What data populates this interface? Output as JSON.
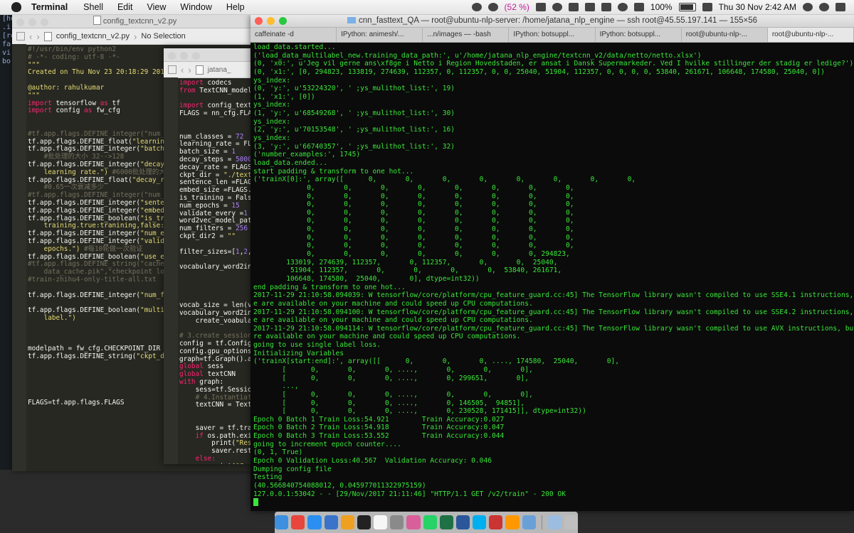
{
  "menubar": {
    "app": "Terminal",
    "menus": [
      "Shell",
      "Edit",
      "View",
      "Window",
      "Help"
    ],
    "battery": "(52 %)",
    "battery_pct": "100%",
    "clock": "Thu 30 Nov  2:42 AM"
  },
  "strip": [
    "[ho",
    ".i",
    "[ro",
    "fa",
    "vi",
    "bo"
  ],
  "editor1": {
    "title": "config_textcnn_v2.py",
    "tab": "config_textcnn_v2.py",
    "selection": "No Selection",
    "lines": [
      [
        {
          "t": "#!/usr/bin/env python2",
          "c": "cm"
        }
      ],
      [
        {
          "t": "# -*- coding: utf-8 -*-",
          "c": "cm"
        }
      ],
      [
        {
          "t": "\"\"\"",
          "c": "str"
        }
      ],
      [
        {
          "t": "Created on Thu Nov 23 20:18:29 201",
          "c": "str"
        }
      ],
      [],
      [
        {
          "t": "@author: rahulkumar",
          "c": "str"
        }
      ],
      [
        {
          "t": "\"\"\"",
          "c": "str"
        }
      ],
      [
        {
          "t": "import ",
          "c": "kw"
        },
        {
          "t": "tensorflow ",
          "c": ""
        },
        {
          "t": "as ",
          "c": "kw"
        },
        {
          "t": "tf",
          "c": ""
        }
      ],
      [
        {
          "t": "import ",
          "c": "kw"
        },
        {
          "t": "config ",
          "c": ""
        },
        {
          "t": "as ",
          "c": "kw"
        },
        {
          "t": "fw_cfg",
          "c": ""
        }
      ],
      [],
      [],
      [
        {
          "t": "#tf.app.flags.DEFINE_integer(\"num_c",
          "c": "cm"
        }
      ],
      [
        {
          "t": "tf.app.flags.DEFINE_float(",
          "c": ""
        },
        {
          "t": "\"learnin",
          "c": "str"
        }
      ],
      [
        {
          "t": "tf.app.flags.DEFINE_integer(",
          "c": ""
        },
        {
          "t": "\"batch_",
          "c": "str"
        }
      ],
      [
        {
          "t": "    #批处理的大小 32-->128",
          "c": "cm"
        }
      ],
      [
        {
          "t": "tf.app.flags.DEFINE_integer(",
          "c": ""
        },
        {
          "t": "\"decay_",
          "c": "str"
        }
      ],
      [
        {
          "t": "    learning rate.\")",
          "c": "str"
        },
        {
          "t": " #6000批处理的大小",
          "c": "cm"
        }
      ],
      [
        {
          "t": "tf.app.flags.DEFINE_float(",
          "c": ""
        },
        {
          "t": "\"decay_ra",
          "c": "str"
        }
      ],
      [
        {
          "t": "    #0.65一次衰减多少",
          "c": "cm"
        }
      ],
      [
        {
          "t": "#tf.app.flags.DEFINE_integer(\"num_s",
          "c": "cm"
        }
      ],
      [
        {
          "t": "tf.app.flags.DEFINE_integer(",
          "c": ""
        },
        {
          "t": "\"senten",
          "c": "str"
        }
      ],
      [
        {
          "t": "tf.app.flags.DEFINE_integer(",
          "c": ""
        },
        {
          "t": "\"embed_",
          "c": "str"
        }
      ],
      [
        {
          "t": "tf.app.flags.DEFINE_boolean(",
          "c": ""
        },
        {
          "t": "\"is_tra",
          "c": "str"
        }
      ],
      [
        {
          "t": "    training.true:tranining,false:te",
          "c": "str"
        }
      ],
      [
        {
          "t": "tf.app.flags.DEFINE_integer(",
          "c": ""
        },
        {
          "t": "\"num_ep",
          "c": "str"
        }
      ],
      [
        {
          "t": "tf.app.flags.DEFINE_integer(",
          "c": ""
        },
        {
          "t": "\"valida",
          "c": "str"
        }
      ],
      [
        {
          "t": "    epochs.\")",
          "c": "str"
        },
        {
          "t": " #每10轮做一次验证",
          "c": "cm"
        }
      ],
      [
        {
          "t": "tf.app.flags.DEFINE_boolean(",
          "c": ""
        },
        {
          "t": "\"use_em",
          "c": "str"
        }
      ],
      [
        {
          "t": "#tf.app.flags.DEFINE_string(\"cache_p",
          "c": "cm"
        }
      ],
      [
        {
          "t": "    data_cache.pik\",\"checkpoint loc",
          "c": "cm"
        }
      ],
      [
        {
          "t": "#train-zhihu4-only-title-all.txt",
          "c": "cm"
        }
      ],
      [],
      [
        {
          "t": "tf.app.flags.DEFINE_integer(",
          "c": ""
        },
        {
          "t": "\"num_fi",
          "c": "str"
        }
      ],
      [],
      [
        {
          "t": "tf.app.flags.DEFINE_boolean(",
          "c": ""
        },
        {
          "t": "\"multi_",
          "c": "str"
        }
      ],
      [
        {
          "t": "    label.\")",
          "c": "str"
        }
      ],
      [],
      [],
      [],
      [
        {
          "t": "modelpath = fw_cfg.CHECKPOINT_DIR",
          "c": ""
        }
      ],
      [
        {
          "t": "tf.app.flags.DEFINE_string(",
          "c": ""
        },
        {
          "t": "\"ckpt_di",
          "c": "str"
        }
      ],
      [],
      [],
      [],
      [],
      [],
      [
        {
          "t": "FLAGS=tf.app.flags.FLAGS",
          "c": ""
        }
      ]
    ]
  },
  "editor2": {
    "tab": "jatana_",
    "lines": [
      [
        {
          "t": "import ",
          "c": "kw"
        },
        {
          "t": "codecs",
          "c": ""
        }
      ],
      [
        {
          "t": "from ",
          "c": "kw"
        },
        {
          "t": "TextCNN_model",
          "c": ""
        }
      ],
      [],
      [
        {
          "t": "import ",
          "c": "kw"
        },
        {
          "t": "config_text",
          "c": ""
        }
      ],
      [
        {
          "t": "FLAGS = nn_cfg.FLA",
          "c": ""
        }
      ],
      [],
      [],
      [
        {
          "t": "num_classes = ",
          "c": ""
        },
        {
          "t": "72",
          "c": "num"
        }
      ],
      [
        {
          "t": "learning_rate = FL",
          "c": ""
        }
      ],
      [
        {
          "t": "batch_size = ",
          "c": ""
        },
        {
          "t": "1",
          "c": "num"
        }
      ],
      [
        {
          "t": "decay_steps = ",
          "c": ""
        },
        {
          "t": "5000",
          "c": "num"
        }
      ],
      [
        {
          "t": "decay_rate = FLAGS",
          "c": ""
        }
      ],
      [
        {
          "t": "ckpt_dir = ",
          "c": ""
        },
        {
          "t": "\"./text",
          "c": "str"
        }
      ],
      [
        {
          "t": "sentence_len =FLAG",
          "c": ""
        }
      ],
      [
        {
          "t": "embed_size =FLAGS.",
          "c": ""
        }
      ],
      [
        {
          "t": "is_training = Fals",
          "c": ""
        }
      ],
      [
        {
          "t": "num_epochs = ",
          "c": ""
        },
        {
          "t": "15",
          "c": "num"
        }
      ],
      [
        {
          "t": "validate_every =",
          "c": ""
        },
        {
          "t": "1",
          "c": "num"
        }
      ],
      [
        {
          "t": "word2vec_model_pat",
          "c": ""
        }
      ],
      [
        {
          "t": "num_filters = ",
          "c": ""
        },
        {
          "t": "256",
          "c": "num"
        }
      ],
      [
        {
          "t": "ckpt_dir2 = ",
          "c": ""
        },
        {
          "t": "\"\"",
          "c": "str"
        }
      ],
      [],
      [
        {
          "t": "filter_sizes=[",
          "c": ""
        },
        {
          "t": "1",
          "c": "num"
        },
        {
          "t": ",",
          "c": ""
        },
        {
          "t": "2",
          "c": "num"
        },
        {
          "t": ",",
          "c": ""
        }
      ],
      [],
      [
        {
          "t": "vocabulary_word2in",
          "c": ""
        }
      ],
      [],
      [],
      [],
      [],
      [
        {
          "t": "vocab_size = len(v",
          "c": ""
        }
      ],
      [
        {
          "t": "vocabulary_word2in",
          "c": ""
        }
      ],
      [
        {
          "t": "    create_voabula",
          "c": ""
        }
      ],
      [],
      [
        {
          "t": "# 3.create session",
          "c": "cm"
        }
      ],
      [
        {
          "t": "config = tf.Config",
          "c": ""
        }
      ],
      [
        {
          "t": "config.gpu_options",
          "c": ""
        }
      ],
      [
        {
          "t": "graph=tf.Graph().a",
          "c": ""
        }
      ],
      [
        {
          "t": "global ",
          "c": "kw"
        },
        {
          "t": "sess",
          "c": ""
        }
      ],
      [
        {
          "t": "global ",
          "c": "kw"
        },
        {
          "t": "textCNN",
          "c": ""
        }
      ],
      [
        {
          "t": "with ",
          "c": "kw"
        },
        {
          "t": "graph:",
          "c": ""
        }
      ],
      [
        {
          "t": "    sess=tf.Sessio",
          "c": ""
        }
      ],
      [
        {
          "t": "    # 4.Instantiat",
          "c": "cm"
        }
      ],
      [
        {
          "t": "    textCNN = Text",
          "c": ""
        }
      ],
      [],
      [],
      [
        {
          "t": "    saver = tf.tra",
          "c": ""
        }
      ],
      [
        {
          "t": "    ",
          "c": ""
        },
        {
          "t": "if ",
          "c": "kw"
        },
        {
          "t": "os.path.exi",
          "c": ""
        }
      ],
      [
        {
          "t": "        print(",
          "c": ""
        },
        {
          "t": "\"Res",
          "c": "str"
        }
      ],
      [
        {
          "t": "        saver.rest",
          "c": ""
        }
      ],
      [
        {
          "t": "    ",
          "c": ""
        },
        {
          "t": "else:",
          "c": "kw"
        }
      ],
      [
        {
          "t": "        print(",
          "c": ""
        },
        {
          "t": "\"Can",
          "c": "str"
        }
      ]
    ]
  },
  "terminal": {
    "title": "cnn_fasttext_QA — root@ubuntu-nlp-server: /home/jatana_nlp_engine — ssh root@45.55.197.141 — 155×56",
    "tabs": [
      {
        "label": "caffeinate -d",
        "active": false
      },
      {
        "label": "IPython: animesh/...",
        "active": false
      },
      {
        "label": "...n/images — -bash",
        "active": false
      },
      {
        "label": "IPython: botsuppl...",
        "active": false
      },
      {
        "label": "IPython: botsuppl...",
        "active": false
      },
      {
        "label": "root@ubuntu-nlp-...",
        "active": false
      },
      {
        "label": "root@ubuntu-nlp-...",
        "active": true
      }
    ],
    "lines": [
      "load_data.started...",
      "('load_data_multilabel_new.training_data_path:', u'/home/jatana_nlp_engine/textcnn_v2/data/netto/netto.xlsx')",
      "(0, 'x0:', u'Jeg vil gerne ans\\xf8ge i Netto i Region Hovedstaden, er ansat i Dansk Supermarkeder. Ved I hvilke stillinger der stadig er ledige?')",
      "(0, 'x1:', [0, 294823, 133819, 274639, 112357, 0, 112357, 0, 0, 25040, 51904, 112357, 0, 0, 0, 0, 53840, 261671, 106648, 174580, 25040, 0])",
      "ys_index:",
      "(0, 'y:', u'53224320', ' ;ys_mulithot_list:', 19)",
      "(1, 'x1:', [0])",
      "ys_index:",
      "(1, 'y:', u'68549268', ' ;ys_mulithot_list:', 30)",
      "ys_index:",
      "(2, 'y:', u'70153548', ' ;ys_mulithot_list:', 16)",
      "ys_index:",
      "(3, 'y:', u'66740357', ' ;ys_mulithot_list:', 32)",
      "('number_examples:', 1745)",
      "load_data.ended...",
      "start padding & transform to one hot...",
      "('trainX[0]:', array([      0,       0,       0,       0,       0,       0,       0,       0,",
      "             0,       0,       0,       0,       0,       0,       0,       0,",
      "             0,       0,       0,       0,       0,       0,       0,       0,",
      "             0,       0,       0,       0,       0,       0,       0,       0,",
      "             0,       0,       0,       0,       0,       0,       0,       0,",
      "             0,       0,       0,       0,       0,       0,       0,       0,",
      "             0,       0,       0,       0,       0,       0,       0,       0,",
      "             0,       0,       0,       0,       0,       0,       0,       0,",
      "             0,       0,       0,       0,       0,       0,       0,       0,",
      "             0,       0,       0,       0,       0,       0,       0, 294823,",
      "        133019, 274639, 112357,       0, 112357,       0,       0,  25040,",
      "         51904, 112357,       0,       0,       0,       0,  53840, 261671,",
      "        106648, 174580,  25040,       0], dtype=int32))",
      "end padding & transform to one hot...",
      "2017-11-29 21:10:58.094039: W tensorflow/core/platform/cpu_feature_guard.cc:45] The TensorFlow library wasn't compiled to use SSE4.1 instructions, but thes",
      "e are available on your machine and could speed up CPU computations.",
      "2017-11-29 21:10:58.094100: W tensorflow/core/platform/cpu_feature_guard.cc:45] The TensorFlow library wasn't compiled to use SSE4.2 instructions, but thes",
      "e are available on your machine and could speed up CPU computations.",
      "2017-11-29 21:10:58.094114: W tensorflow/core/platform/cpu_feature_guard.cc:45] The TensorFlow library wasn't compiled to use AVX instructions, but these a",
      "re available on your machine and could speed up CPU computations.",
      "going to use single label loss.",
      "Initializing Variables",
      "('trainX[start:end]:', array([[      0,       0,       0, ...., 174580,  25040,       0],",
      "       [      0,       0,       0, ....,       0,       0,       0],",
      "       [      0,       0,       0, ....,       0, 299651,       0],",
      "       ...,",
      "       [      0,       0,       0, ....,       0,       0,       0],",
      "       [      0,       0,       0, ....,       0, 146505,  94851],",
      "       [      0,       0,       0, ....,       0, 230528, 171415]], dtype=int32))",
      "Epoch 0 Batch 1 Train Loss:54.921        Train Accuracy:0.027",
      "Epoch 0 Batch 2 Train Loss:54.918        Train Accuracy:0.047",
      "Epoch 0 Batch 3 Train Loss:53.552        Train Accuracy:0.044",
      "going to increment epoch counter....",
      "(0, 1, True)",
      "Epoch 0 Validation Loss:40.567  Validation Accuracy: 0.046",
      "Dumping config file",
      "Testing",
      "(40.566840754088012, 0.045977011322975159)",
      "127.0.0.1:53042 - - [29/Nov/2017 21:11:46] \"HTTP/1.1 GET /v2/train\" - 200 OK"
    ]
  },
  "dock": {
    "icons": [
      {
        "name": "finder-icon",
        "color": "#3d8fe0"
      },
      {
        "name": "chrome-icon",
        "color": "#e8453c"
      },
      {
        "name": "safari-icon",
        "color": "#2a8ff0"
      },
      {
        "name": "xcode-icon",
        "color": "#3a73c9"
      },
      {
        "name": "pages-icon",
        "color": "#f0a020"
      },
      {
        "name": "terminal-icon",
        "color": "#222222"
      },
      {
        "name": "calendar-icon",
        "color": "#f6f6f6"
      },
      {
        "name": "system-preferences-icon",
        "color": "#8a8a8a"
      },
      {
        "name": "photos-icon",
        "color": "#d95f9a"
      },
      {
        "name": "whatsapp-icon",
        "color": "#25d366"
      },
      {
        "name": "excel-icon",
        "color": "#1e7145"
      },
      {
        "name": "word-icon",
        "color": "#2b579a"
      },
      {
        "name": "skype-icon",
        "color": "#00aff0"
      },
      {
        "name": "app-icon",
        "color": "#cc3333"
      },
      {
        "name": "sublime-text-icon",
        "color": "#ff9800"
      },
      {
        "name": "preview-icon",
        "color": "#6aa0d8"
      },
      {
        "name": "finder-window-icon",
        "color": "#9cbde0"
      },
      {
        "name": "trash-icon",
        "color": "#bfbfbf"
      }
    ]
  }
}
